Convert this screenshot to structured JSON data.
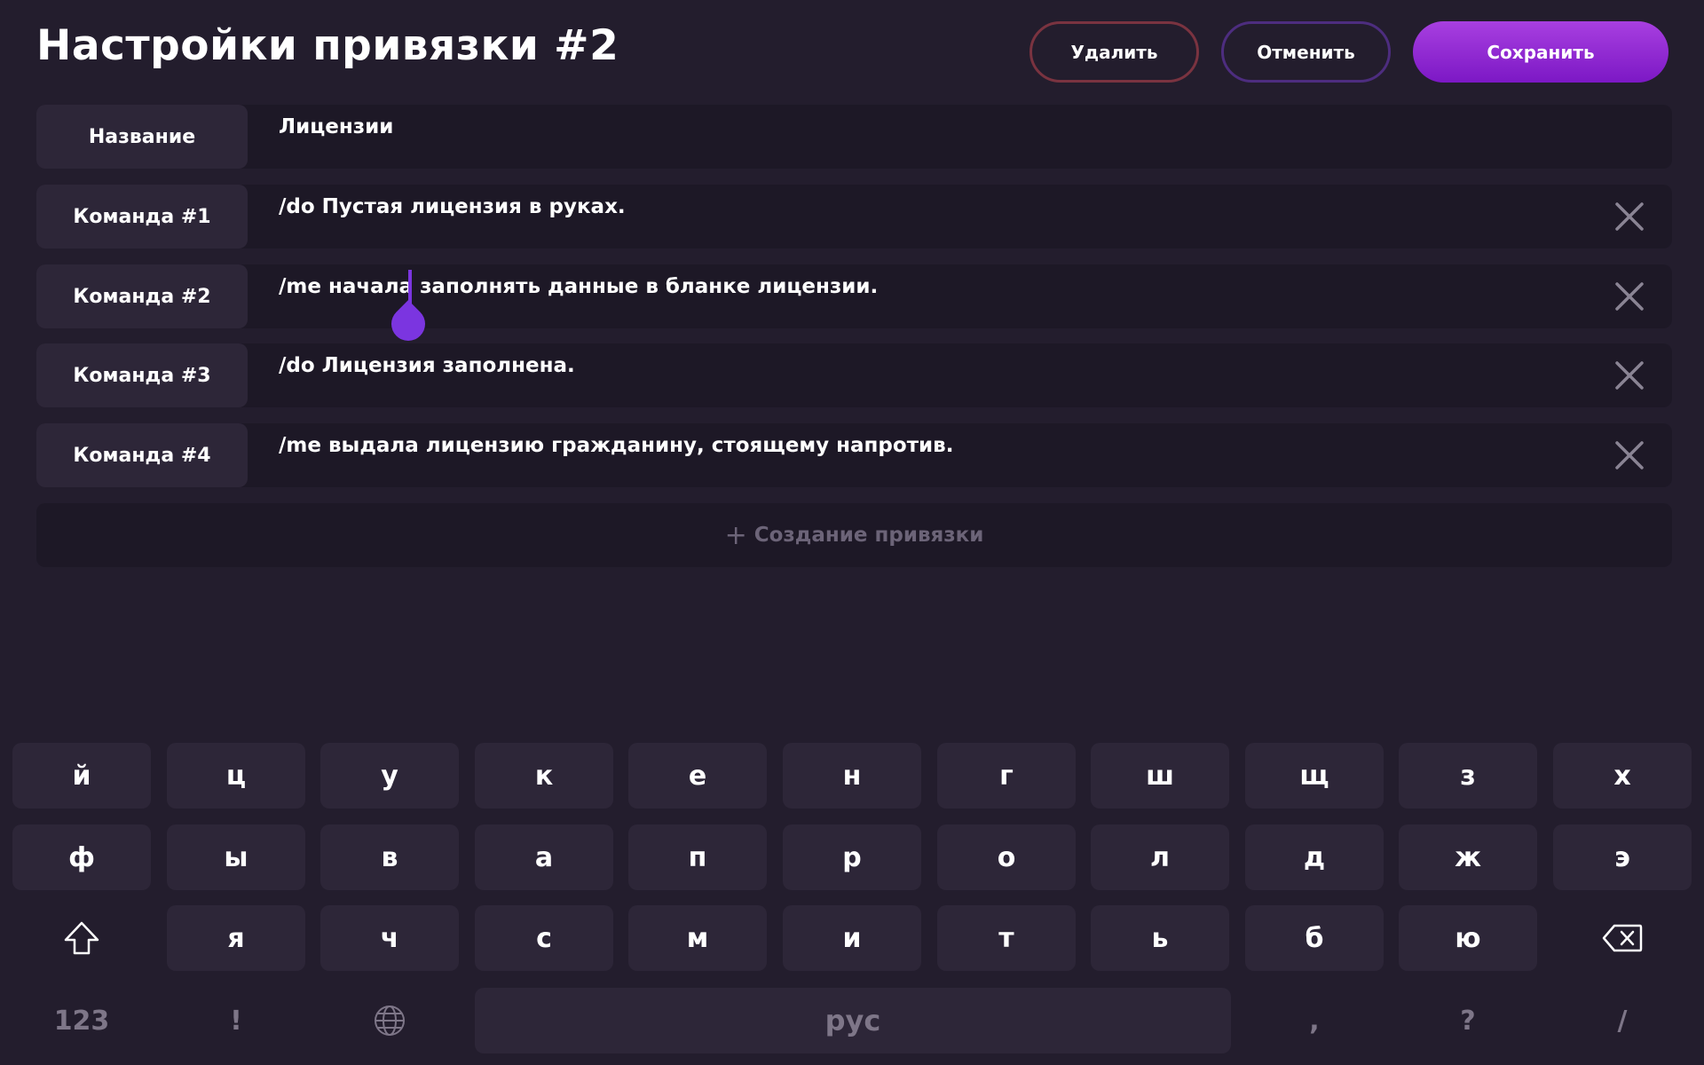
{
  "header": {
    "title": "Настройки привязки #2",
    "delete_label": "Удалить",
    "cancel_label": "Отменить",
    "save_label": "Сохранить"
  },
  "fields": [
    {
      "label": "Название",
      "value": "Лицензии"
    },
    {
      "label": "Команда #1",
      "value": "/do Пустая лицензия в руках."
    },
    {
      "label": "Команда #2",
      "value": "/me начала заполнять данные в бланке лицензии."
    },
    {
      "label": "Команда #3",
      "value": "/do Лицензия заполнена."
    },
    {
      "label": "Команда #4",
      "value": "/me выдала лицензию гражданину, стоящему напротив."
    }
  ],
  "add_binding_label": "Создание привязки",
  "keyboard": {
    "row1": [
      "й",
      "ц",
      "у",
      "к",
      "е",
      "н",
      "г",
      "ш",
      "щ",
      "з",
      "х"
    ],
    "row2": [
      "ф",
      "ы",
      "в",
      "а",
      "п",
      "р",
      "о",
      "л",
      "д",
      "ж",
      "э"
    ],
    "row3": [
      "я",
      "ч",
      "с",
      "м",
      "и",
      "т",
      "ь",
      "б",
      "ю"
    ],
    "row4": {
      "numbers": "123",
      "exclaim": "!",
      "space": "рус",
      "comma": ",",
      "question": "?",
      "slash": "/"
    }
  },
  "colors": {
    "background": "#231d2d",
    "accent": "#8a2be2",
    "delete_border": "#7a3340",
    "cancel_border": "#4d2d7f"
  },
  "icons": {
    "close": "close-icon",
    "shift": "shift-icon",
    "backspace": "backspace-icon",
    "globe": "globe-icon",
    "plus": "plus-icon"
  }
}
